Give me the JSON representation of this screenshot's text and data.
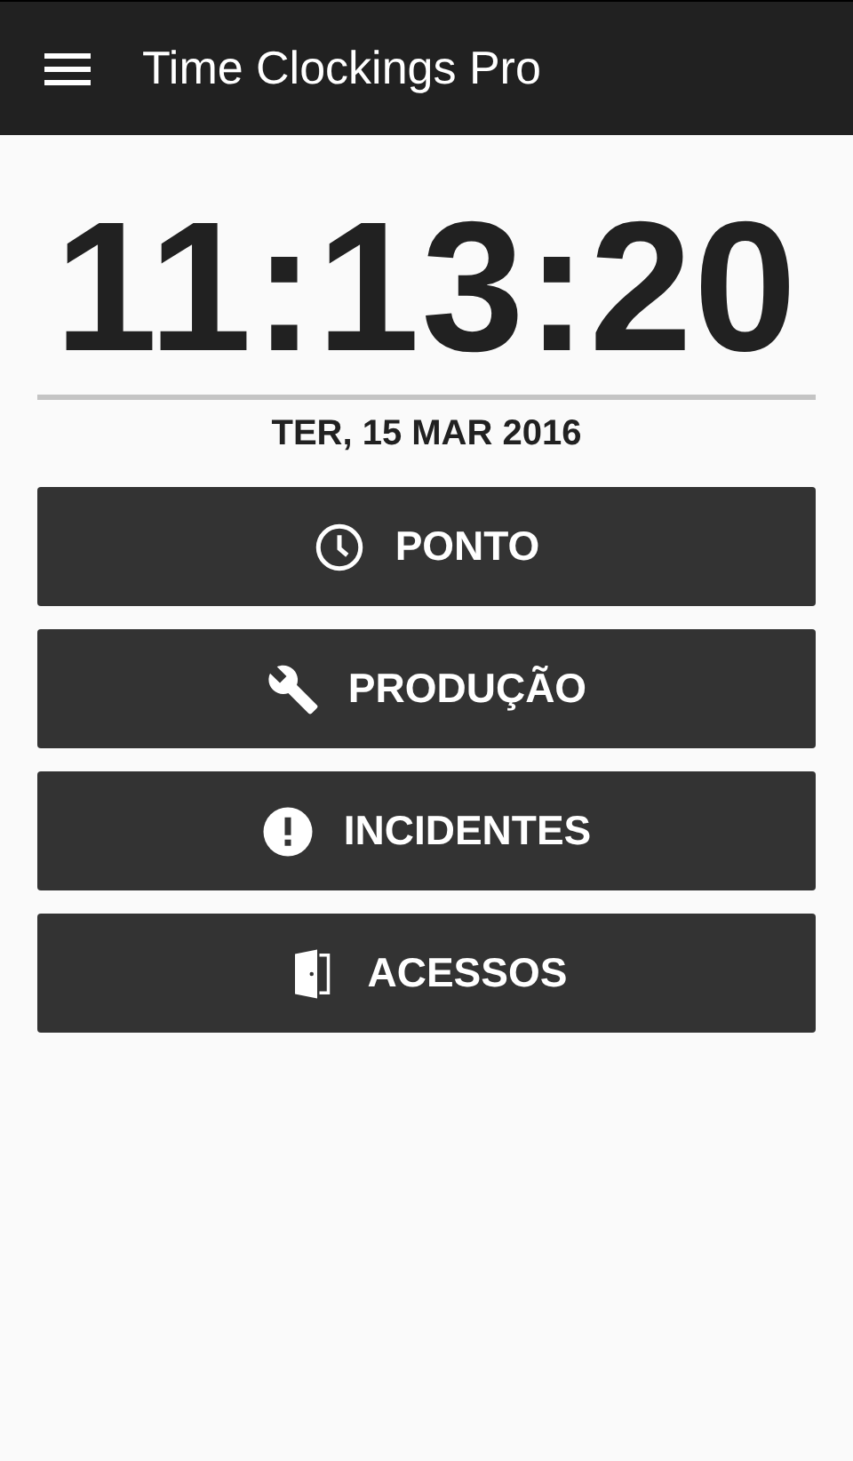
{
  "app_bar": {
    "title": "Time Clockings Pro"
  },
  "clock": {
    "time": "11:13:20",
    "date": "TER, 15 MAR 2016"
  },
  "buttons": [
    {
      "kind": "clock",
      "label": "PONTO"
    },
    {
      "kind": "wrench",
      "label": "PRODUÇÃO"
    },
    {
      "kind": "alert",
      "label": "INCIDENTES"
    },
    {
      "kind": "door",
      "label": "ACESSOS"
    }
  ]
}
